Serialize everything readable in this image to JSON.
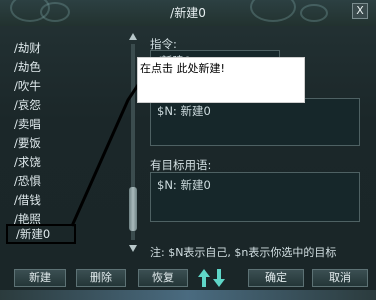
{
  "window": {
    "title": "/新建0",
    "close_label": "X"
  },
  "list": {
    "items": [
      "/劫财",
      "/劫色",
      "/吹牛",
      "/哀怨",
      "/卖唱",
      "/要饭",
      "/求饶",
      "/恐惧",
      "/借钱",
      "/艳照"
    ],
    "selected": "/新建0"
  },
  "command": {
    "label": "指令:",
    "value": "/新建0"
  },
  "popup": {
    "text": "在点击 此处新建!"
  },
  "no_target": {
    "value": "$N: 新建0"
  },
  "has_target": {
    "label": "有目标用语:",
    "value": "$N: 新建0"
  },
  "note": "注: $N表示自己, $n表示你选中的目标",
  "buttons": {
    "new": "新建",
    "delete": "删除",
    "restore": "恢复",
    "ok": "确定",
    "cancel": "取消"
  }
}
